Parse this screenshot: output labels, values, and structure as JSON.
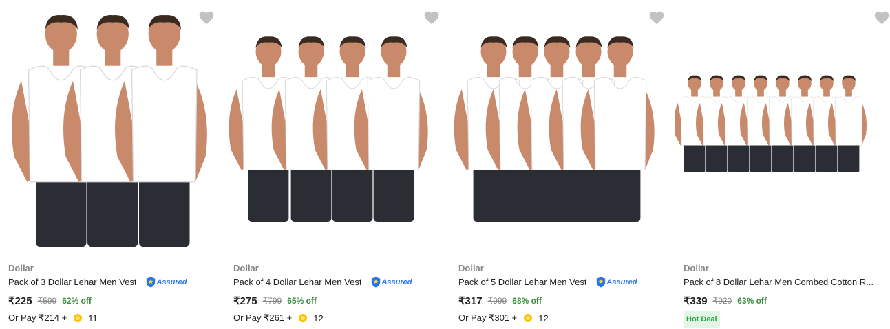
{
  "products": [
    {
      "brand": "Dollar",
      "title": "Pack of 3 Dollar Lehar Men Vest",
      "assured": "Assured",
      "price": "₹225",
      "mrp": "₹599",
      "discount": "62% off",
      "pay_prefix": "Or Pay ₹214 +",
      "coins": "11",
      "image_alt": "3 men wearing white vests"
    },
    {
      "brand": "Dollar",
      "title": "Pack of 4 Dollar Lehar Men Vest",
      "assured": "Assured",
      "price": "₹275",
      "mrp": "₹799",
      "discount": "65% off",
      "pay_prefix": "Or Pay ₹261 +",
      "coins": "12",
      "image_alt": "4 men wearing white vests"
    },
    {
      "brand": "Dollar",
      "title": "Pack of 5 Dollar Lehar Men Vest",
      "assured": "Assured",
      "price": "₹317",
      "mrp": "₹999",
      "discount": "68% off",
      "pay_prefix": "Or Pay ₹301 +",
      "coins": "12",
      "image_alt": "5 men wearing white vests"
    },
    {
      "brand": "Dollar",
      "title": "Pack of 8 Dollar Lehar Men Combed Cotton R...",
      "price": "₹339",
      "mrp": "₹920",
      "discount": "63% off",
      "badge": "Hot Deal",
      "image_alt": "8 men wearing white vests"
    }
  ],
  "icons": {
    "wishlist": "heart-icon",
    "assured": "shield-icon",
    "coin": "supercoin-icon"
  },
  "colors": {
    "discount": "#388e3c",
    "assured_blue": "#2874f0",
    "hot_deal_bg": "#e3f6e5",
    "coin": "#ffc200"
  }
}
